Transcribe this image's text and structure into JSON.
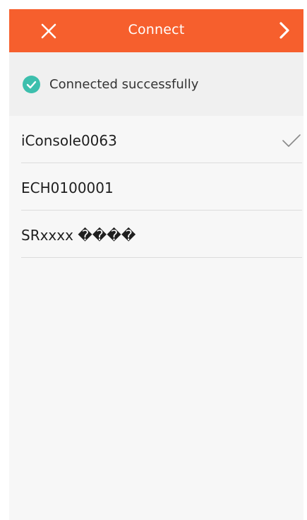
{
  "header": {
    "title": "Connect",
    "close_icon": "close-icon",
    "next_icon": "chevron-right-icon",
    "background": "#f65f2d"
  },
  "status": {
    "text": "Connected successfully",
    "icon": "check-circle-icon",
    "icon_color": "#3dbfad"
  },
  "devices": [
    {
      "name": "iConsole0063",
      "selected": true
    },
    {
      "name": "ECH0100001",
      "selected": false
    },
    {
      "name": "SRxxxx ����",
      "selected": false
    }
  ]
}
